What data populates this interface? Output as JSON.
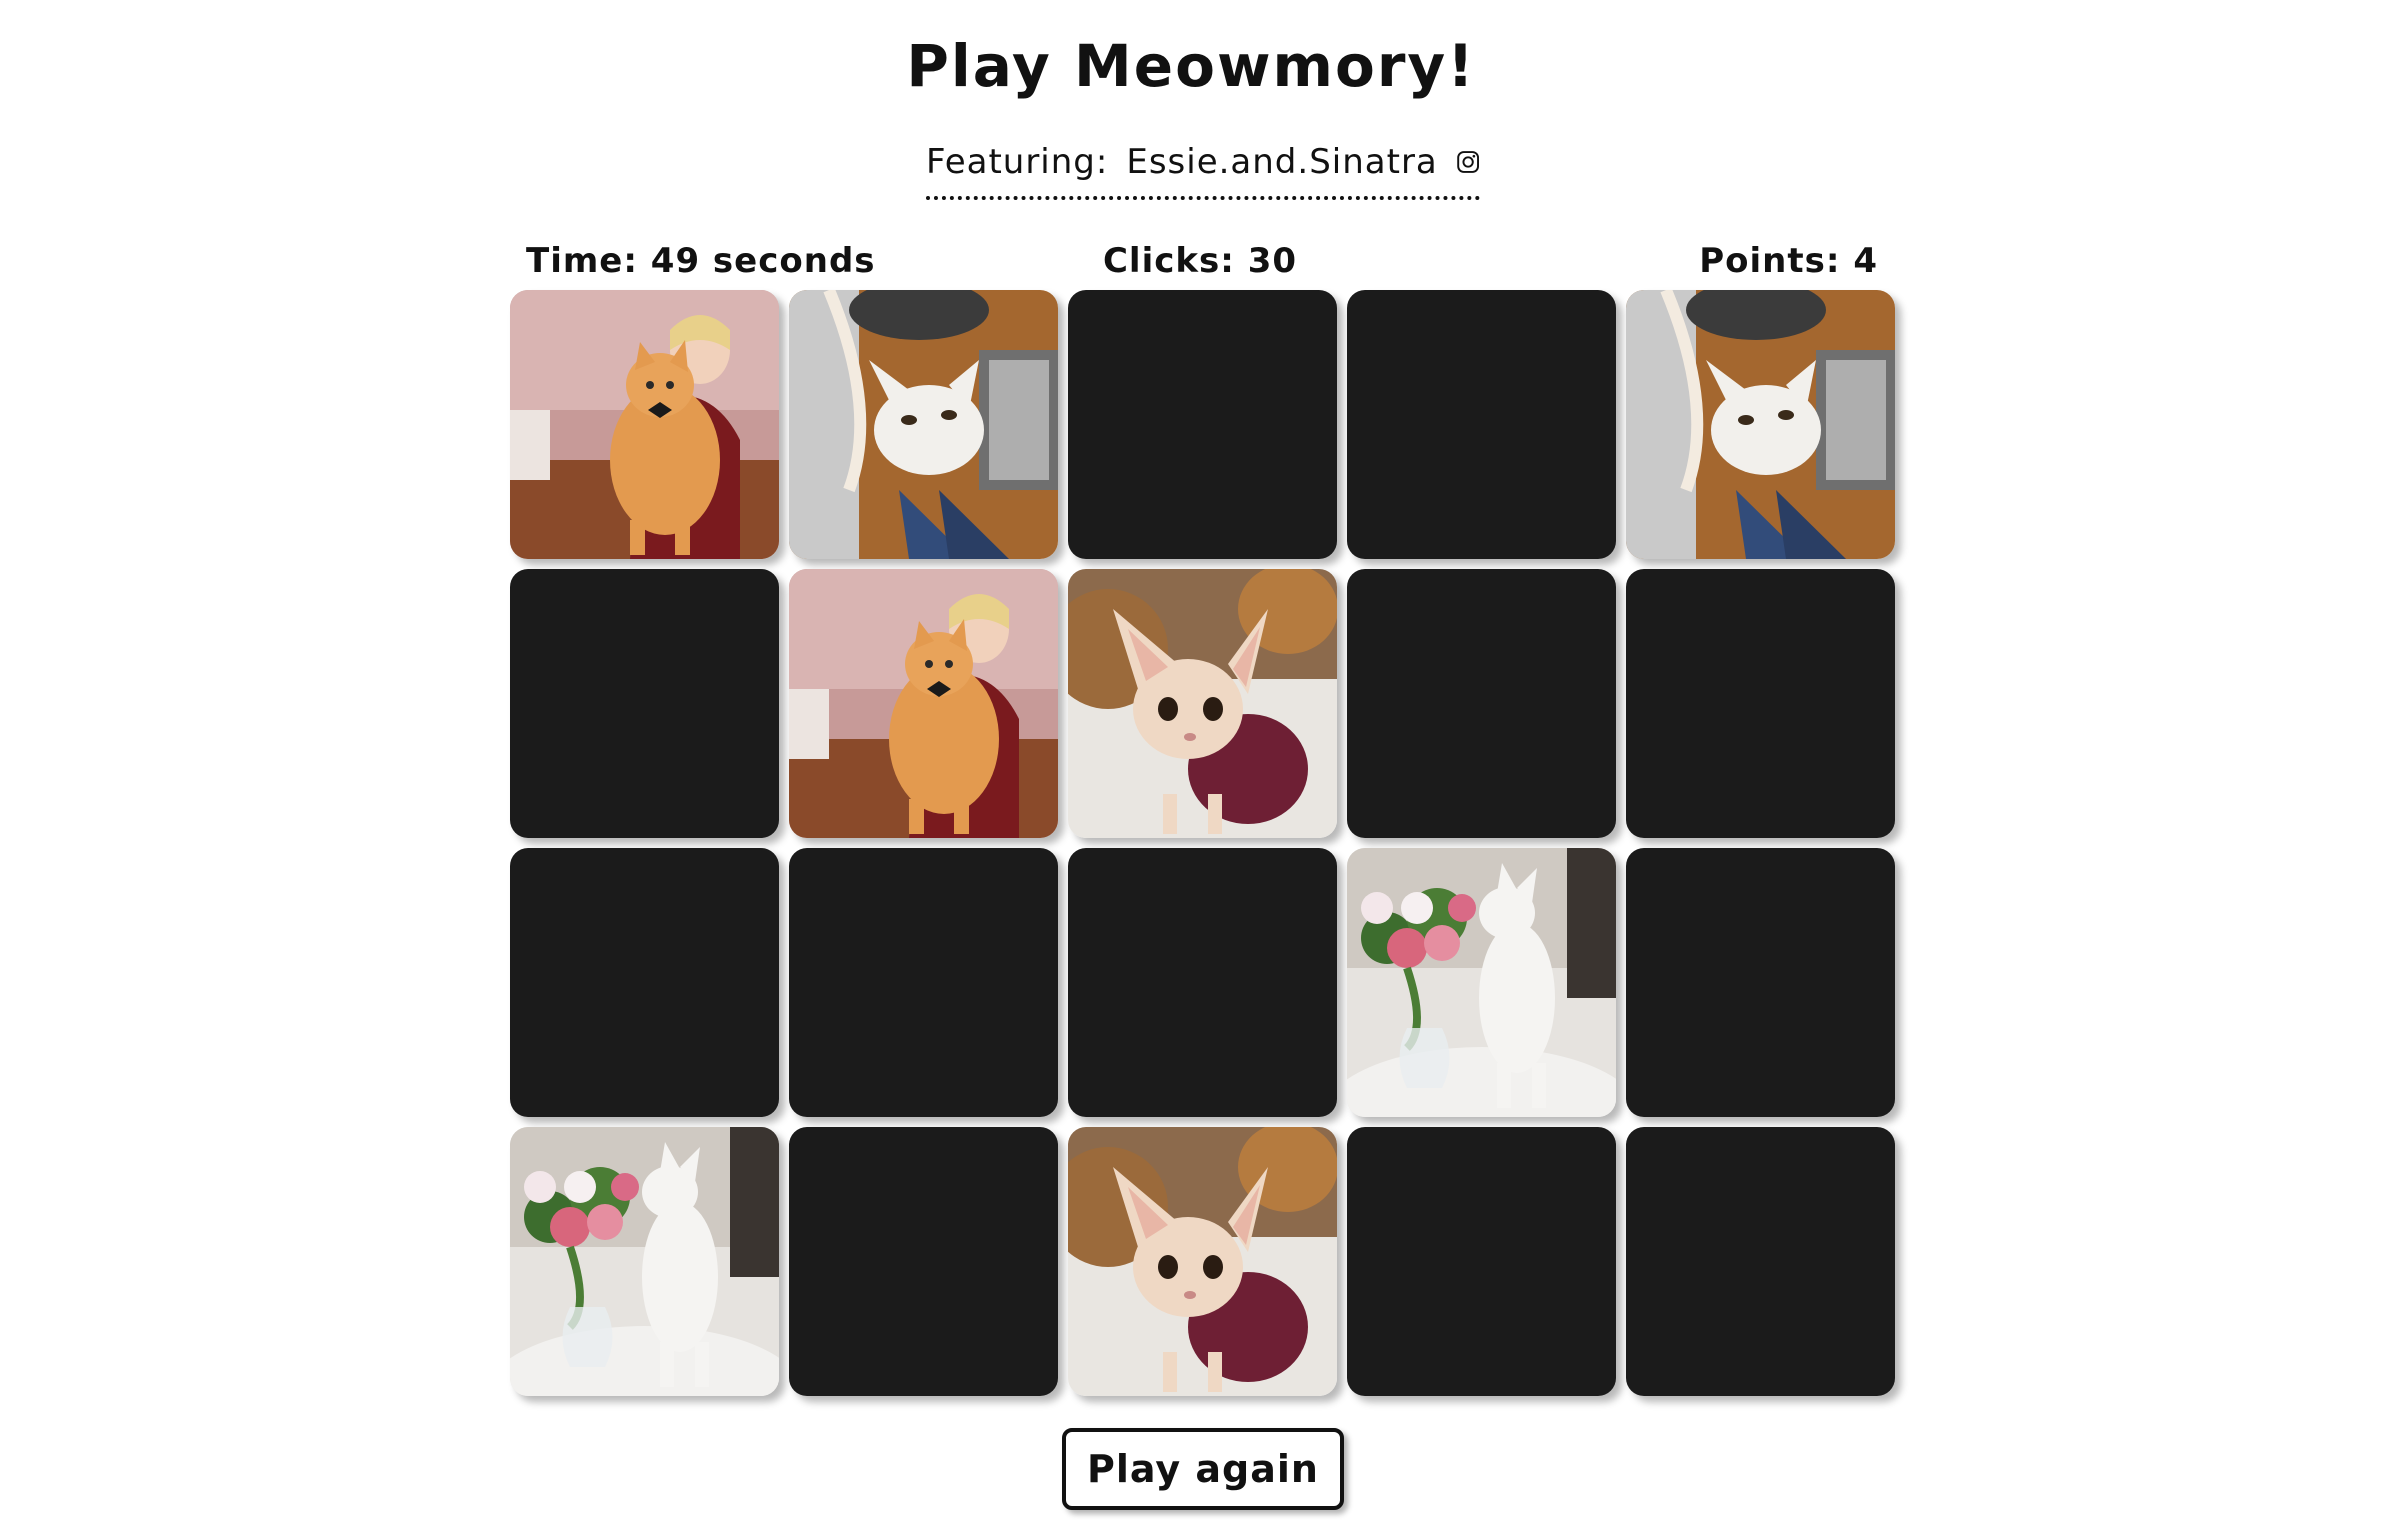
{
  "header": {
    "title": "Play Meowmory!",
    "featuring_label": "Featuring:",
    "featuring_account": "Essie.and.Sinatra",
    "featuring_icon": "instagram-icon"
  },
  "stats": {
    "time_label": "Time:",
    "time_value": "49 seconds",
    "clicks_label": "Clicks:",
    "clicks_value": "30",
    "points_label": "Points:",
    "points_value": "4"
  },
  "board": {
    "columns": 5,
    "rows": 4,
    "card_back_color": "#1b1b1b",
    "cards": [
      {
        "state": "revealed",
        "photo": "ginger-longhair-cat-with-bowtie-held-by-woman"
      },
      {
        "state": "revealed",
        "photo": "white-cat-by-scratching-post-looking-up"
      },
      {
        "state": "hidden",
        "photo": ""
      },
      {
        "state": "hidden",
        "photo": ""
      },
      {
        "state": "revealed",
        "photo": "white-cat-by-scratching-post-looking-up"
      },
      {
        "state": "hidden",
        "photo": ""
      },
      {
        "state": "revealed",
        "photo": "ginger-longhair-cat-with-bowtie-held-by-woman"
      },
      {
        "state": "revealed",
        "photo": "devon-rex-cat-in-burgundy-sweater"
      },
      {
        "state": "hidden",
        "photo": ""
      },
      {
        "state": "hidden",
        "photo": ""
      },
      {
        "state": "hidden",
        "photo": ""
      },
      {
        "state": "hidden",
        "photo": ""
      },
      {
        "state": "hidden",
        "photo": ""
      },
      {
        "state": "revealed",
        "photo": "white-cat-sniffing-flower-bouquet"
      },
      {
        "state": "hidden",
        "photo": ""
      },
      {
        "state": "revealed",
        "photo": "white-cat-sniffing-flower-bouquet"
      },
      {
        "state": "hidden",
        "photo": ""
      },
      {
        "state": "revealed",
        "photo": "devon-rex-cat-in-burgundy-sweater"
      },
      {
        "state": "hidden",
        "photo": ""
      },
      {
        "state": "hidden",
        "photo": ""
      }
    ]
  },
  "actions": {
    "play_again_label": "Play again"
  }
}
